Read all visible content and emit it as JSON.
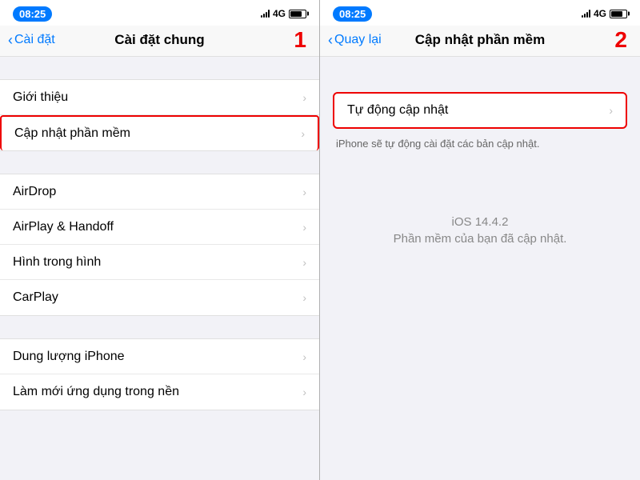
{
  "left_panel": {
    "status_time": "08:25",
    "network": "4G",
    "nav_back_label": "Cài đặt",
    "nav_title": "Cài đặt chung",
    "step_number": "1",
    "section1": {
      "rows": [
        {
          "label": "Giới thiệu",
          "has_chevron": true
        },
        {
          "label": "Cập nhật phần mềm",
          "has_chevron": true,
          "highlighted": true
        }
      ]
    },
    "section2": {
      "rows": [
        {
          "label": "AirDrop",
          "has_chevron": true
        },
        {
          "label": "AirPlay & Handoff",
          "has_chevron": true
        },
        {
          "label": "Hình trong hình",
          "has_chevron": true
        },
        {
          "label": "CarPlay",
          "has_chevron": true
        }
      ]
    },
    "section3": {
      "rows": [
        {
          "label": "Dung lượng iPhone",
          "has_chevron": true
        },
        {
          "label": "Làm mới ứng dụng trong nền",
          "has_chevron": true
        }
      ]
    }
  },
  "right_panel": {
    "status_time": "08:25",
    "network": "4G",
    "nav_back_label": "Quay lại",
    "nav_title": "Cập nhật phần mềm",
    "step_number": "2",
    "auto_update_label": "Tự động cập nhật",
    "description": "iPhone sẽ tự động cài đặt các bản cập nhật.",
    "ios_version": "iOS 14.4.2",
    "update_status": "Phần mềm của bạn đã cập nhật."
  }
}
